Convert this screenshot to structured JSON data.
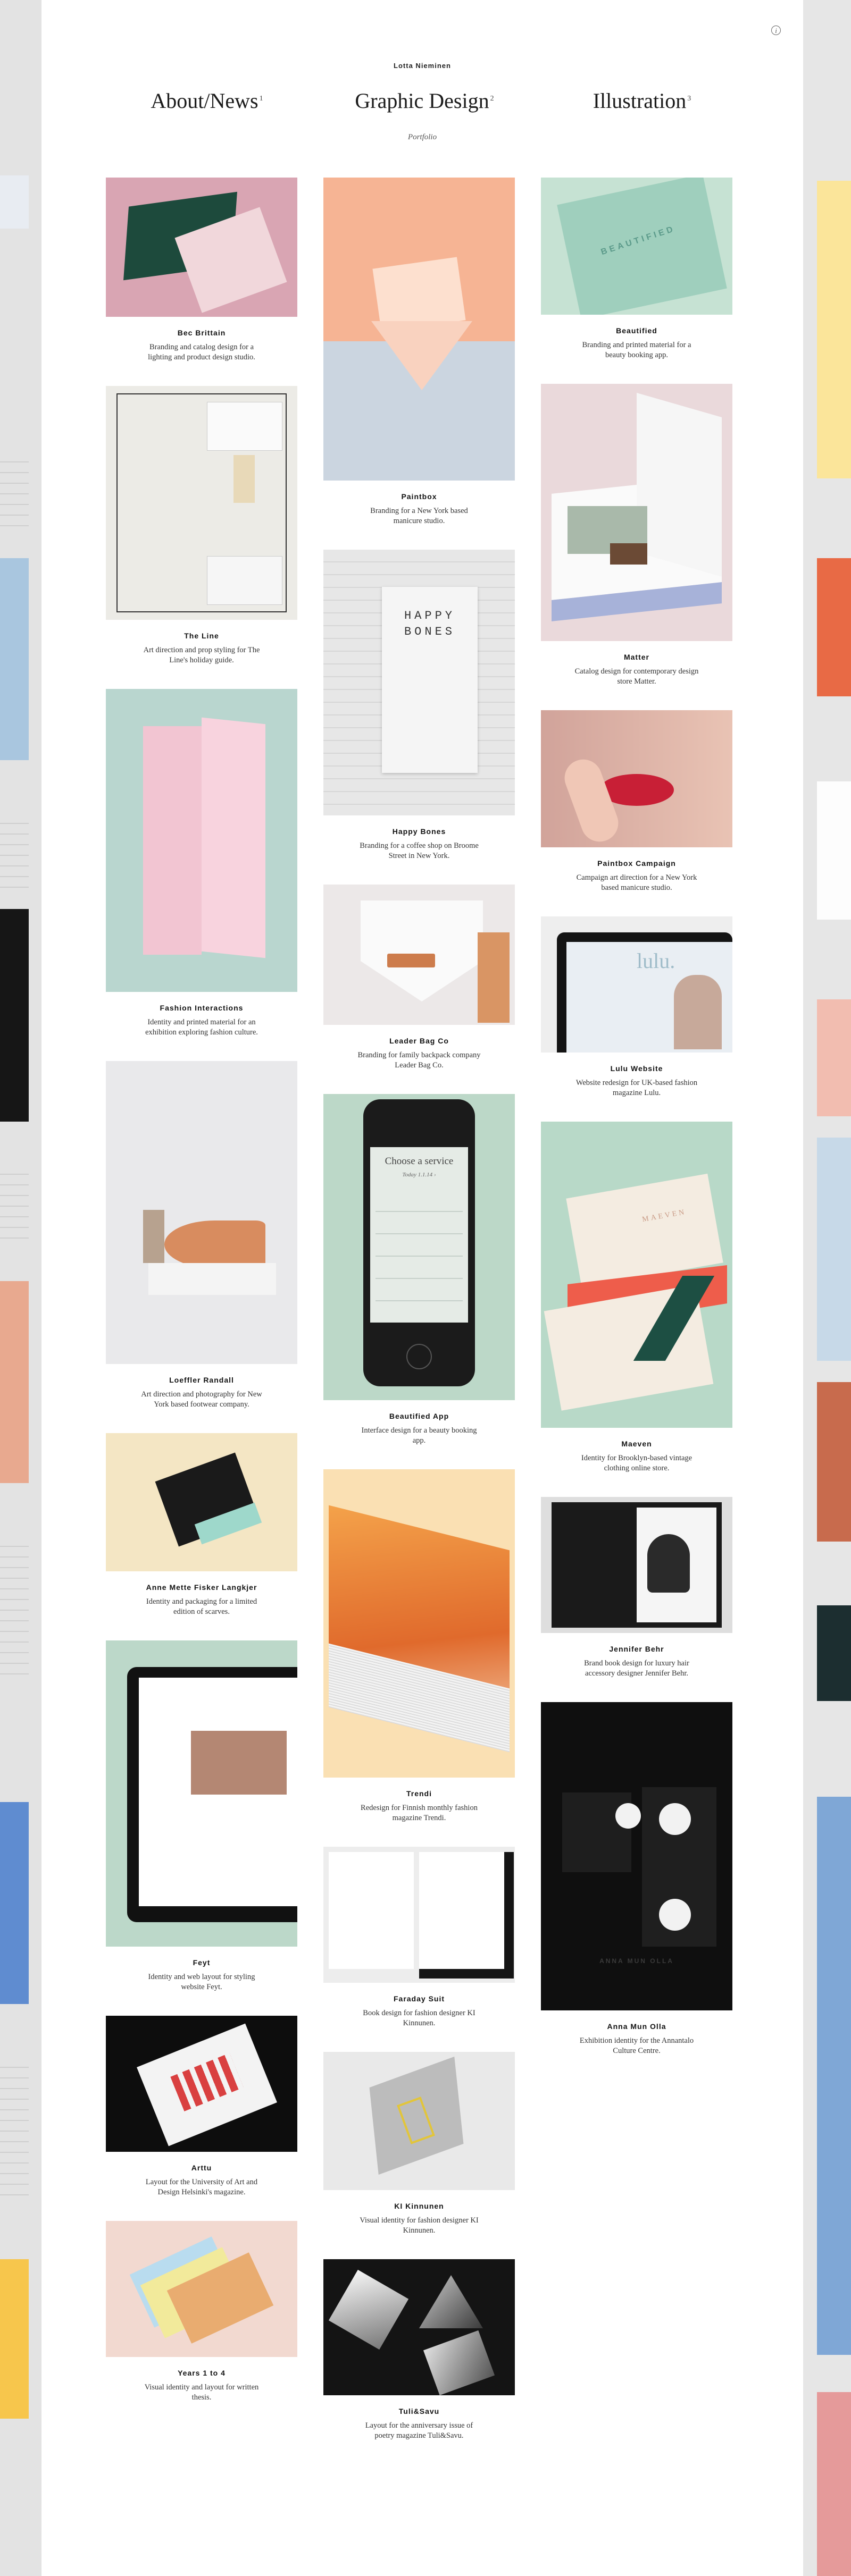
{
  "header": {
    "author": "Lotta Nieminen",
    "categories": [
      {
        "label": "About/News",
        "sup": "1"
      },
      {
        "label": "Graphic Design",
        "sup": "2"
      },
      {
        "label": "Illustration",
        "sup": "3"
      }
    ],
    "subtitle": "Portfolio",
    "info_glyph": "i"
  },
  "columns": [
    [
      {
        "title": "Bec Brittain",
        "desc": "Branding and catalog design for a lighting and product design studio.",
        "bg": "#d9a5b3"
      },
      {
        "title": "The Line",
        "desc": "Art direction and prop styling for The Line's holiday guide.",
        "bg": "#ecebe6"
      },
      {
        "title": "Fashion Interactions",
        "desc": "Identity and printed material for an exhibition exploring fashion culture.",
        "bg": "#b9d6cf"
      },
      {
        "title": "Loeffler Randall",
        "desc": "Art direction and photography for New York based footwear company.",
        "bg": "#e9e9eb"
      },
      {
        "title": "Anne Mette Fisker Langkjer",
        "desc": "Identity and packaging for a limited edition of scarves.",
        "bg": "#f4e6c4"
      },
      {
        "title": "Feyt",
        "desc": "Identity and web layout for styling website Feyt.",
        "bg": "#bcd8c9"
      },
      {
        "title": "Arttu",
        "desc": "Layout for the University of Art and Design Helsinki's magazine.",
        "bg": "#0d0d0d"
      },
      {
        "title": "Years 1 to 4",
        "desc": "Visual identity and layout for written thesis.",
        "bg": "#f2d9d0"
      }
    ],
    [
      {
        "title": "Paintbox",
        "desc": "Branding for a New York based manicure studio.",
        "bg": "#f6b494"
      },
      {
        "title": "Happy Bones",
        "desc": "Branding for a coffee shop on Broome Street in New York.",
        "bg": "#e0e0e0",
        "sign_title": "HAPPY BONES"
      },
      {
        "title": "Leader Bag Co",
        "desc": "Branding for family backpack company Leader Bag Co.",
        "bg": "#ece8e8"
      },
      {
        "title": "Beautified App",
        "desc": "Interface design for a beauty booking app.",
        "bg": "#bcd8c8",
        "screen_title": "Choose a service",
        "screen_sub": "Today 1.1.14 ›"
      },
      {
        "title": "Trendi",
        "desc": "Redesign for Finnish monthly fashion magazine Trendi.",
        "bg": "#fae0b3"
      },
      {
        "title": "Faraday Suit",
        "desc": "Book design for fashion designer KI Kinnunen.",
        "bg": "#ededed"
      },
      {
        "title": "KI Kinnunen",
        "desc": "Visual identity for fashion designer KI Kinnunen.",
        "bg": "#e9e9e9"
      },
      {
        "title": "Tuli&Savu",
        "desc": "Layout for the anniversary issue of poetry magazine Tuli&Savu.",
        "bg": "#141414"
      }
    ],
    [
      {
        "title": "Beautified",
        "desc": "Branding and printed material for a beauty booking app.",
        "bg": "#c6e2d3",
        "word": "BEAUTIFIED"
      },
      {
        "title": "Matter",
        "desc": "Catalog design for contemporary design store Matter.",
        "bg": "#ead9db"
      },
      {
        "title": "Paintbox Campaign",
        "desc": "Campaign art direction for a New York based manicure studio.",
        "bg": "#c78e88"
      },
      {
        "title": "Lulu Website",
        "desc": "Website redesign for UK-based fashion magazine Lulu.",
        "bg": "#eeeeee",
        "word": "lulu."
      },
      {
        "title": "Maeven",
        "desc": "Identity for Brooklyn-based vintage clothing online store.",
        "bg": "#b8d9c8",
        "word": "MAEVEN"
      },
      {
        "title": "Jennifer Behr",
        "desc": "Brand book design for luxury hair accessory designer Jennifer Behr.",
        "bg": "#dedede"
      },
      {
        "title": "Anna Mun Olla",
        "desc": "Exhibition identity for the Annantalo Culture Centre.",
        "bg": "#0f0f0f",
        "word": "ANNA MUN OLLA"
      }
    ]
  ]
}
